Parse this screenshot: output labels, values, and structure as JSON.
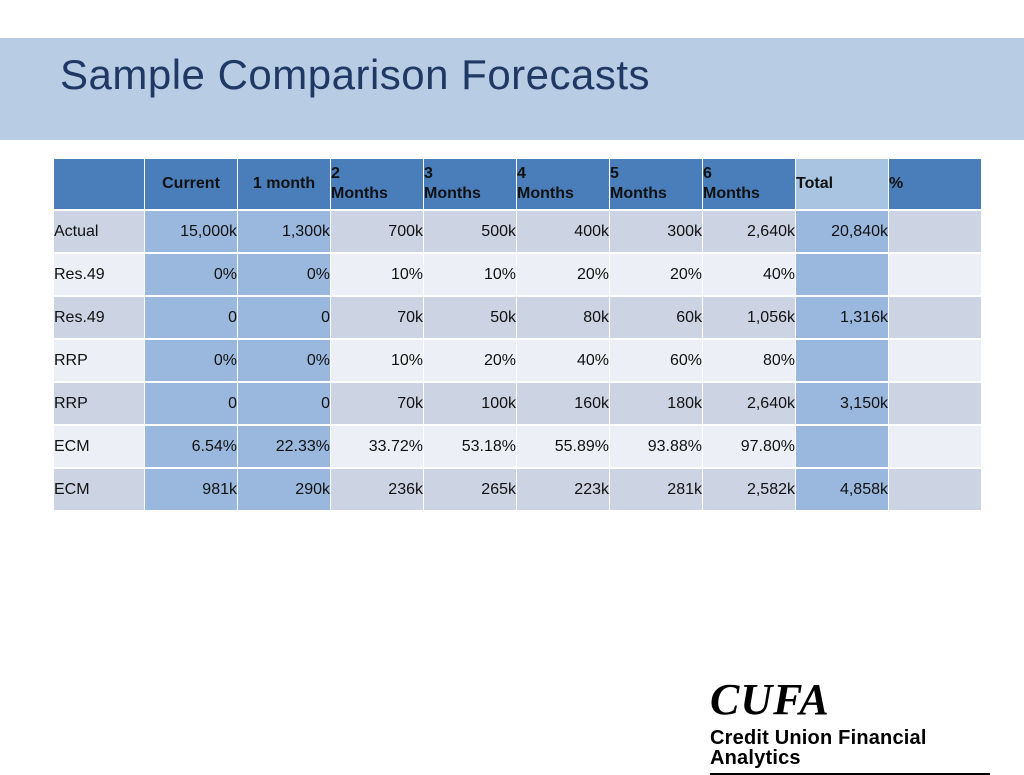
{
  "slide": {
    "title": "Sample Comparison Forecasts",
    "band_color": "#b8cce4",
    "title_color": "#1f3864",
    "background": "#ffffff"
  },
  "table": {
    "header_color": "#4a7ebb",
    "header_total_color": "#a8c4e0",
    "highlight_color": "#9ab8dd",
    "band_dark": "#ccd3e3",
    "band_light": "#eceff6",
    "columns": [
      {
        "key": "label",
        "line1": "",
        "line2": "",
        "style": "blank"
      },
      {
        "key": "current",
        "line1": "Current",
        "line2": "",
        "style": "center"
      },
      {
        "key": "m1",
        "line1": "1 month",
        "line2": "",
        "style": "center"
      },
      {
        "key": "m2",
        "line1": "2",
        "line2": "Months",
        "style": "stacked"
      },
      {
        "key": "m3",
        "line1": "3",
        "line2": "Months",
        "style": "stacked"
      },
      {
        "key": "m4",
        "line1": "4",
        "line2": "Months",
        "style": "stacked"
      },
      {
        "key": "m5",
        "line1": "5",
        "line2": "Months",
        "style": "stacked"
      },
      {
        "key": "m6",
        "line1": "6",
        "line2": "Months",
        "style": "stacked"
      },
      {
        "key": "total",
        "line1": "Total",
        "line2": "",
        "style": "total"
      },
      {
        "key": "percent",
        "line1": "%",
        "line2": "",
        "style": "pct"
      }
    ],
    "rows": [
      {
        "label": "Actual",
        "current": "15,000k",
        "m1": "1,300k",
        "m2": "700k",
        "m3": "500k",
        "m4": "400k",
        "m5": "300k",
        "m6": "2,640k",
        "total": "20,840k",
        "percent": ""
      },
      {
        "label": "Res.49",
        "current": "0%",
        "m1": "0%",
        "m2": "10%",
        "m3": "10%",
        "m4": "20%",
        "m5": "20%",
        "m6": "40%",
        "total": "",
        "percent": ""
      },
      {
        "label": "Res.49",
        "current": "0",
        "m1": "0",
        "m2": "70k",
        "m3": "50k",
        "m4": "80k",
        "m5": "60k",
        "m6": "1,056k",
        "total": "1,316k",
        "percent": ""
      },
      {
        "label": "RRP",
        "current": "0%",
        "m1": "0%",
        "m2": "10%",
        "m3": "20%",
        "m4": "40%",
        "m5": "60%",
        "m6": "80%",
        "total": "",
        "percent": ""
      },
      {
        "label": "RRP",
        "current": "0",
        "m1": "0",
        "m2": "70k",
        "m3": "100k",
        "m4": "160k",
        "m5": "180k",
        "m6": "2,640k",
        "total": "3,150k",
        "percent": ""
      },
      {
        "label": "ECM",
        "current": "6.54%",
        "m1": "22.33%",
        "m2": "33.72%",
        "m3": "53.18%",
        "m4": "55.89%",
        "m5": "93.88%",
        "m6": "97.80%",
        "total": "",
        "percent": ""
      },
      {
        "label": "ECM",
        "current": "981k",
        "m1": "290k",
        "m2": "236k",
        "m3": "265k",
        "m4": "223k",
        "m5": "281k",
        "m6": "2,582k",
        "total": "4,858k",
        "percent": ""
      }
    ]
  },
  "logo": {
    "name": "CUFA",
    "tagline": "Credit Union Financial Analytics"
  }
}
